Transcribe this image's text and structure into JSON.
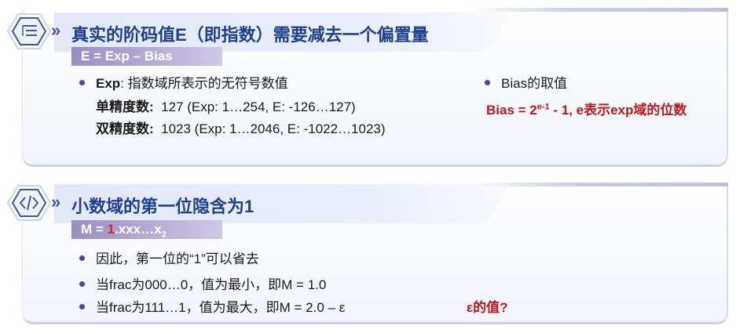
{
  "section1": {
    "title": "真实的阶码值E（即指数）需要减去一个偏置量",
    "formula": "E = Exp – Bias",
    "exp_label": "Exp",
    "exp_desc": ": 指数域所表示的无符号数值",
    "single_label": "单精度数:",
    "single_value": "127   (Exp: 1…254,   E: -126…127)",
    "double_label": "双精度数:",
    "double_value": "1023 (Exp: 1…2046, E: -1022…1023)",
    "bias_bullet": "Bias的取值",
    "bias_formula_a": "Bias = 2",
    "bias_formula_sup": "e-1",
    "bias_formula_b": " - 1, e表示exp域的位数"
  },
  "section2": {
    "title": "小数域的第一位隐含为1",
    "formula_prefix": "M = ",
    "formula_red": "1",
    "formula_rest": ".xxx…x",
    "formula_sub": "2",
    "items": [
      "因此，第一位的“1”可以省去",
      "当frac为000…0，值为最小，即M = 1.0",
      "当frac为111…1，值为最大，即M = 2.0 – ε"
    ],
    "note": "ε的值?"
  },
  "icons": {
    "section1": "list-icon",
    "section2": "code-icon"
  },
  "colors": {
    "title": "#1f3f8f",
    "bullet": "#5a3fa0",
    "accent_red": "#c0161c",
    "formula_bg": "#9a8fc4"
  }
}
